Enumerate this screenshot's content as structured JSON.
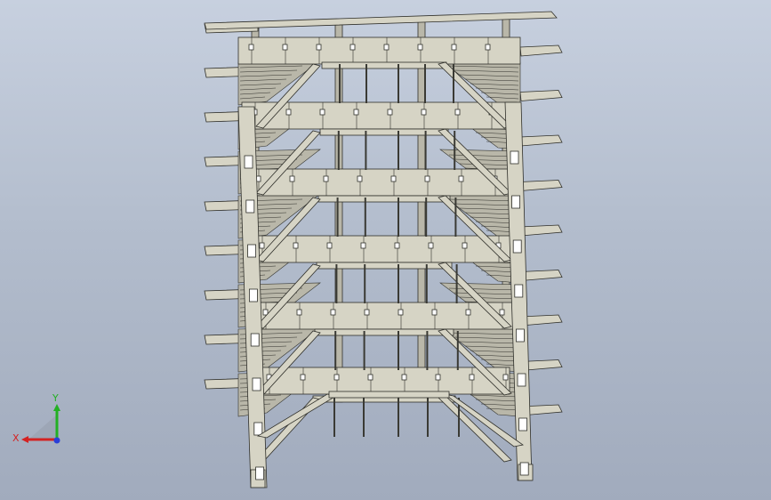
{
  "viewport": {
    "name": "3d-graphics-area"
  },
  "model": {
    "frame_color": "#d6d4c5",
    "edge_color": "#2f2f2a",
    "shade_color": "#b9b7a9",
    "levels": 8
  },
  "triad": {
    "x_label": "X",
    "y_label": "Y",
    "x_color": "#d42222",
    "y_color": "#23b023",
    "z_color": "#2a3fd8"
  }
}
